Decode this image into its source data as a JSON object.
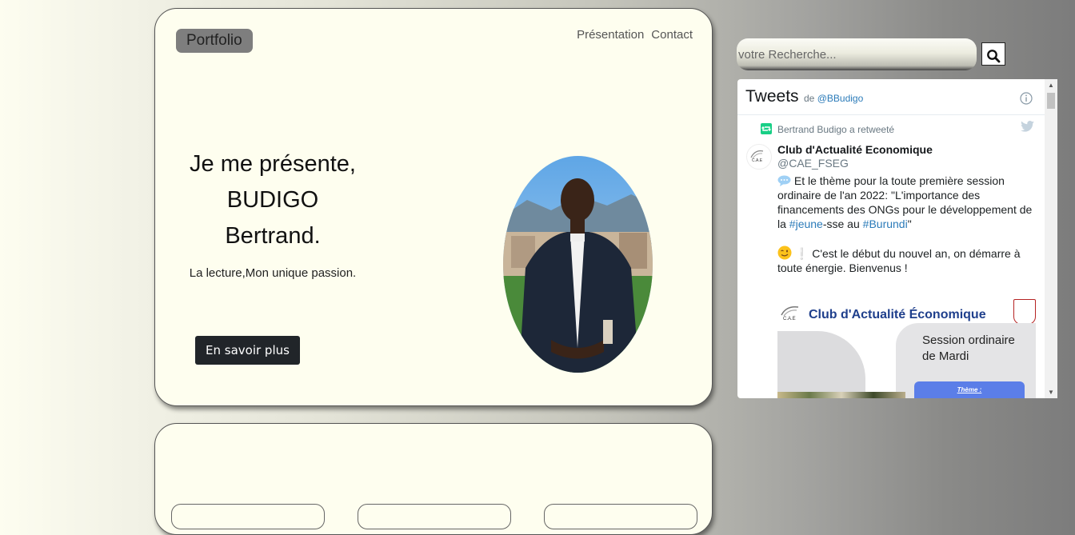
{
  "hero": {
    "brand": "Portfolio",
    "nav": [
      "Présentation",
      "Contact"
    ],
    "intro_lines": [
      "Je me présente,",
      "BUDIGO",
      "Bertrand."
    ],
    "subline": "La lecture,Mon unique passion.",
    "cta_label": "En savoir plus"
  },
  "search": {
    "placeholder": "votre Recherche...",
    "icon": "search-icon"
  },
  "timeline": {
    "title": "Tweets",
    "by_prefix": "de",
    "by_handle": "@BBudigo",
    "retweet_text": "Bertrand Budigo a retweeté",
    "tweet": {
      "author": "Club d'Actualité Economique",
      "handle": "@CAE_FSEG",
      "p1_before": "Et le thème pour la toute première session ordinaire de l'an 2022: \"L'importance des financements des ONGs pour le développement de la ",
      "tag1": "#jeune",
      "p1_mid": "-sse au ",
      "tag2": "#Burundi",
      "p1_end": "\"",
      "p2": "C'est le début du nouvel an, on démarre à toute énergie. Bienvenus !",
      "media": {
        "club_title": "Club d'Actualité Économique",
        "logo_text": "C.A.E",
        "session_line1": "Session ordinaire",
        "session_line2": "de Mardi",
        "theme_label": "Thème :"
      }
    }
  },
  "colors": {
    "card_bg": "#fefeef",
    "cta_bg": "#212529",
    "brand_bg": "#7e7e7e",
    "link": "#2b7bb9"
  }
}
